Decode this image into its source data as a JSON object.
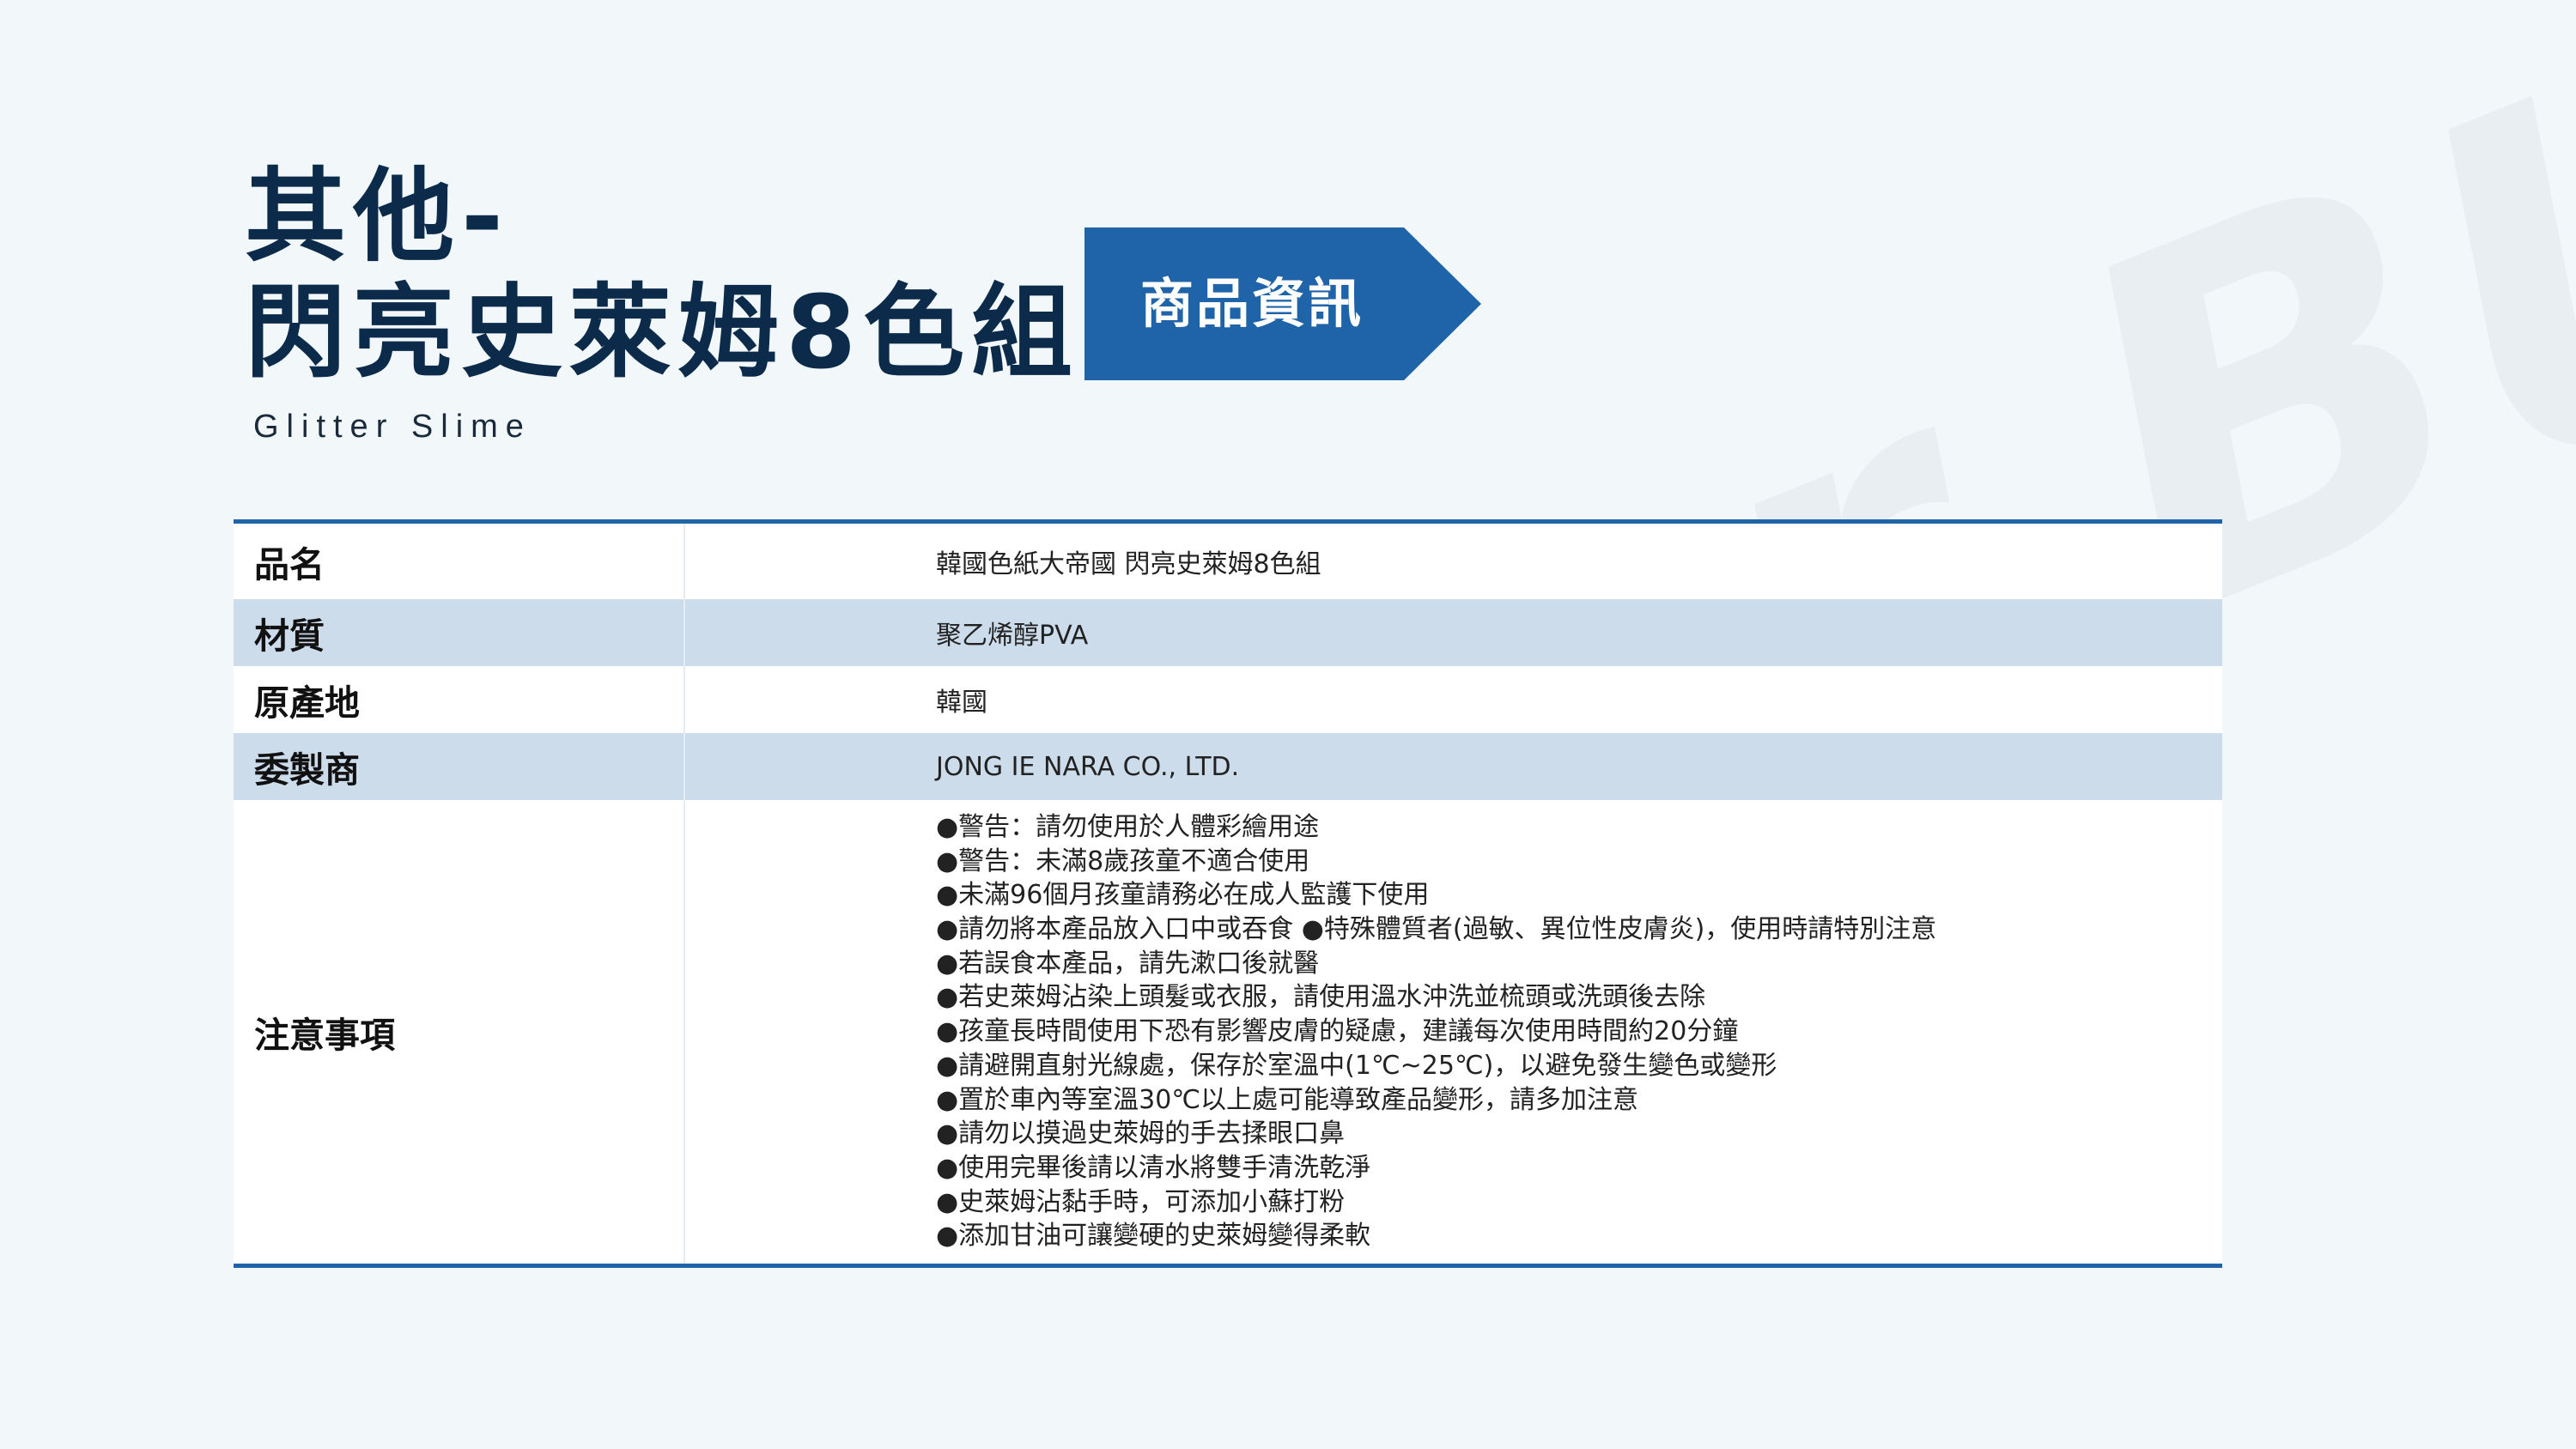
{
  "header": {
    "title_line1": "其他-",
    "title_line2": "閃亮史萊姆8色組",
    "subtitle": "Glitter Slime",
    "badge_label": "商品資訊"
  },
  "watermark": {
    "text": "Cheer BUY!"
  },
  "colors": {
    "background": "#f2f8fa",
    "title": "#0c2a4a",
    "accent": "#1f64a8",
    "row_shade": "#ccdcea"
  },
  "table": {
    "rows": [
      {
        "label": "品名",
        "value": "韓國色紙大帝國 閃亮史萊姆8色組"
      },
      {
        "label": "材質",
        "value": "聚乙烯醇PVA"
      },
      {
        "label": "原產地",
        "value": "韓國"
      },
      {
        "label": "委製商",
        "value": "JONG IE NARA CO., LTD."
      }
    ],
    "notes": {
      "label": "注意事項",
      "items": [
        "●警告：請勿使用於人體彩繪用途",
        "●警告：未滿8歲孩童不適合使用",
        "●未滿96個月孩童請務必在成人監護下使用",
        "●請勿將本產品放入口中或吞食 ●特殊體質者(過敏、異位性皮膚炎)，使用時請特別注意",
        "●若誤食本產品，請先漱口後就醫",
        "●若史萊姆沾染上頭髮或衣服，請使用溫水沖洗並梳頭或洗頭後去除",
        "●孩童長時間使用下恐有影響皮膚的疑慮，建議每次使用時間約20分鐘",
        "●請避開直射光線處，保存於室溫中(1℃~25℃)，以避免發生變色或變形",
        "●置於車內等室溫30℃以上處可能導致產品變形，請多加注意",
        "●請勿以摸過史萊姆的手去揉眼口鼻",
        "●使用完畢後請以清水將雙手清洗乾淨",
        "●史萊姆沾黏手時，可添加小蘇打粉",
        "●添加甘油可讓變硬的史萊姆變得柔軟"
      ]
    }
  }
}
